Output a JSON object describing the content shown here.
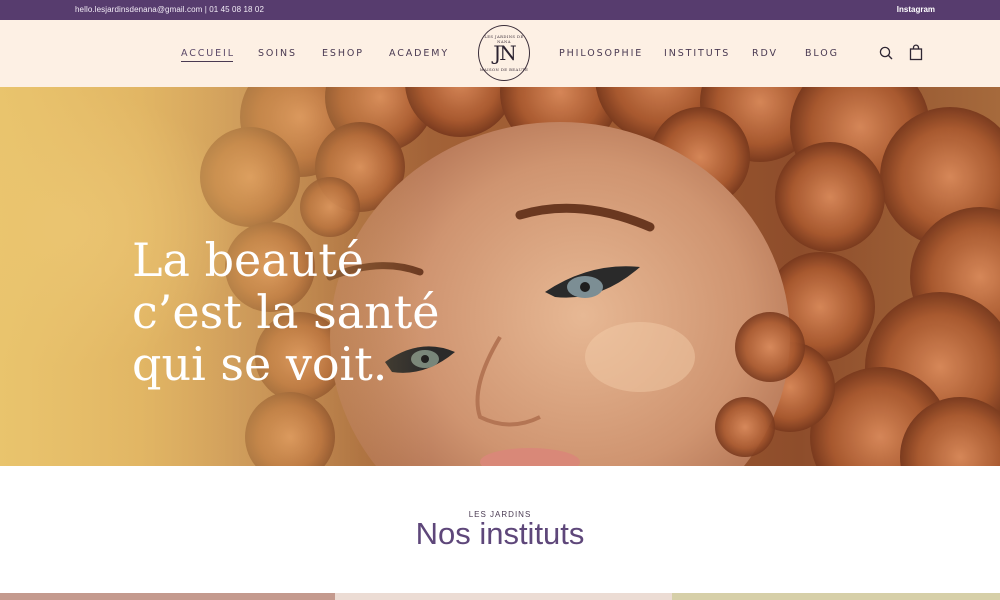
{
  "topbar": {
    "contact": "hello.lesjardinsdenana@gmail.com | 01 45 08 18 02",
    "instagram": "Instagram"
  },
  "nav": {
    "left": [
      {
        "label": "ACCUEIL",
        "active": true
      },
      {
        "label": "SOINS"
      },
      {
        "label": "ESHOP"
      },
      {
        "label": "ACADEMY"
      }
    ],
    "right": [
      {
        "label": "PHILOSOPHIE"
      },
      {
        "label": "INSTITUTS"
      },
      {
        "label": "RDV"
      },
      {
        "label": "BLOG"
      }
    ]
  },
  "logo": {
    "monogram": "JN",
    "ring_top": "LES JARDINS DE NANA",
    "ring_bottom": "MAISON DE BEAUTÉ"
  },
  "icons": {
    "search": "search-icon",
    "cart": "shopping-bag-icon"
  },
  "hero": {
    "line1": "La beauté",
    "line2": "c’est la santé",
    "line3": "qui se voit."
  },
  "section": {
    "eyebrow": "LES JARDINS",
    "heading": "Nos instituts"
  },
  "colors": {
    "topbar": "#573c6e",
    "header": "#fdf0e4",
    "heading": "#5e477a",
    "card1": "#c49a8e",
    "card2": "#ecdcd4",
    "card3": "#d6cfa8"
  }
}
